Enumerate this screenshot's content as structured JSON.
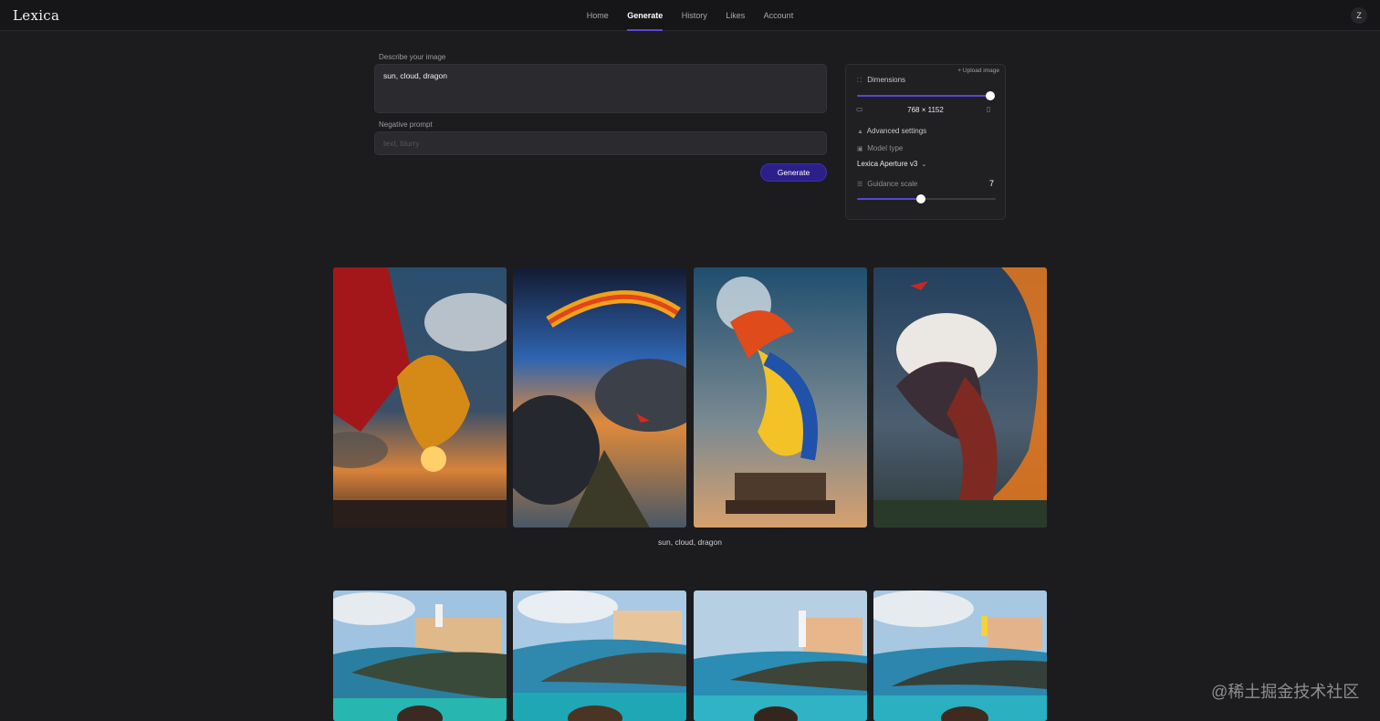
{
  "header": {
    "logo": "Lexica",
    "nav": [
      "Home",
      "Generate",
      "History",
      "Likes",
      "Account"
    ],
    "active_nav": "Generate",
    "avatar_initial": "Z"
  },
  "form": {
    "prompt_label": "Describe your image",
    "prompt_value": "sun, cloud, dragon",
    "negative_label": "Negative prompt",
    "negative_placeholder": "text, blurry",
    "generate_label": "Generate"
  },
  "settings": {
    "upload_label": "+ Upload image",
    "dimensions_label": "Dimensions",
    "dimensions_value": "768 × 1152",
    "dimensions_slider_fraction": 1.0,
    "advanced_label": "Advanced settings",
    "model_type_label": "Model type",
    "model_value": "Lexica Aperture v3",
    "guidance_label": "Guidance scale",
    "guidance_value": "7",
    "guidance_slider_fraction": 0.46
  },
  "results": [
    {
      "caption": "sun, cloud, dragon",
      "images": [
        "dragon-sunset",
        "rainbow-mountain",
        "dragon-on-pedestal",
        "dragon-fire-cliff"
      ]
    },
    {
      "caption": "",
      "images": [
        "coastal-town-1",
        "coastal-town-2",
        "coastal-town-3",
        "coastal-town-4"
      ]
    }
  ],
  "colors": {
    "accent": "#5646d6",
    "button": "#2d1f8a",
    "background": "#1c1c1f"
  },
  "watermark": "@稀土掘金技术社区"
}
